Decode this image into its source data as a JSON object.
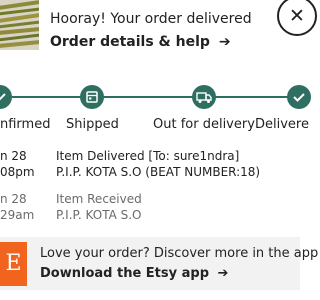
{
  "header": {
    "title": "Hooray! Your order delivered",
    "link_label": "Order details & help",
    "link_arrow": "➔",
    "close_glyph": "✕"
  },
  "stepper": {
    "steps": [
      {
        "label": "nfirmed",
        "icon": "checkmark-icon"
      },
      {
        "label": "Shipped",
        "icon": "shipping-box-icon"
      },
      {
        "label": "Out for delivery",
        "icon": "delivery-truck-icon"
      },
      {
        "label": "Delivere",
        "icon": "checkmark-icon"
      }
    ]
  },
  "timeline": [
    {
      "date": "n 28",
      "time": "08pm",
      "event": "Item Delivered [To: sure1ndra]",
      "location": "P.I.P. KOTA S.O (BEAT NUMBER:18)",
      "status": "current"
    },
    {
      "date": "n 28",
      "time": "29am",
      "event": "Item Received",
      "location": "P.I.P. KOTA S.O",
      "status": "past"
    }
  ],
  "footer": {
    "logo_letter": "E",
    "text": "Love your order? Discover more in the app",
    "link_label": "Download the Etsy app",
    "link_arrow": "➔"
  },
  "colors": {
    "accent": "#2f6f62",
    "etsy_orange": "#f1641e",
    "footer_bg": "#f2f2f2",
    "muted_text": "#6b6b6b"
  }
}
